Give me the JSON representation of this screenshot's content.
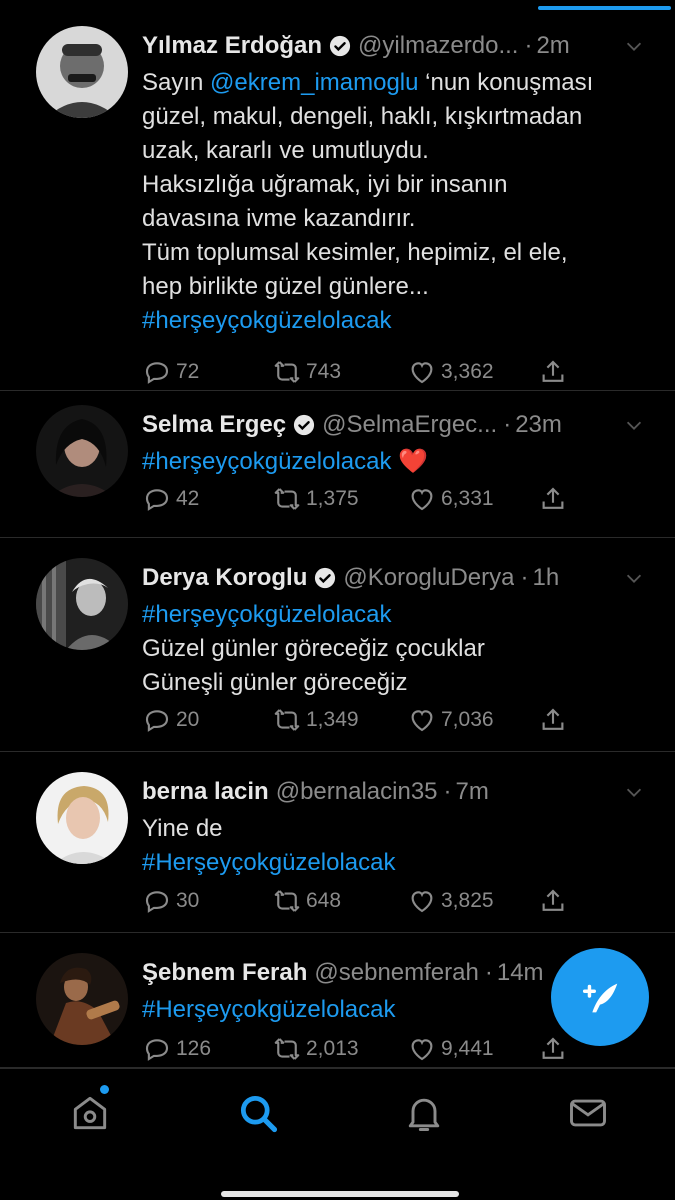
{
  "colors": {
    "accent": "#1d9bf0",
    "background": "#000000",
    "text": "#e0e0e0",
    "muted": "#8b8b8b",
    "heart": "#e0245e"
  },
  "tweets": [
    {
      "name": "Yılmaz Erdoğan",
      "verified": true,
      "handle": "@yilmazerdo...",
      "dot": "·",
      "time": "2m",
      "lines": [
        {
          "parts": [
            {
              "t": "Sayın ",
              "k": "text"
            },
            {
              "t": "@ekrem_imamoglu",
              "k": "mention"
            },
            {
              "t": " ‘nun konuşması",
              "k": "text"
            }
          ]
        },
        {
          "parts": [
            {
              "t": "güzel, makul, dengeli, haklı, kışkırtmadan",
              "k": "text"
            }
          ]
        },
        {
          "parts": [
            {
              "t": "uzak, kararlı ve umutluydu.",
              "k": "text"
            }
          ]
        },
        {
          "parts": [
            {
              "t": "Haksızlığa uğramak, iyi bir insanın",
              "k": "text"
            }
          ]
        },
        {
          "parts": [
            {
              "t": "davasına ivme kazandırır.",
              "k": "text"
            }
          ]
        },
        {
          "parts": [
            {
              "t": "Tüm toplumsal kesimler, hepimiz, el ele,",
              "k": "text"
            }
          ]
        },
        {
          "parts": [
            {
              "t": "hep birlikte güzel günlere...",
              "k": "text"
            }
          ]
        },
        {
          "parts": [
            {
              "t": "#herşeyçokgüzelolacak",
              "k": "hashtag"
            }
          ]
        }
      ],
      "replies": "72",
      "retweets": "743",
      "likes": "3,362"
    },
    {
      "name": "Selma Ergeç",
      "verified": true,
      "handle": "@SelmaErgec...",
      "dot": "·",
      "time": "23m",
      "lines": [
        {
          "parts": [
            {
              "t": "#herşeyçokgüzelolacak",
              "k": "hashtag"
            },
            {
              "t": " ❤️",
              "k": "emoji"
            }
          ]
        }
      ],
      "replies": "42",
      "retweets": "1,375",
      "likes": "6,331"
    },
    {
      "name": "Derya Koroglu",
      "verified": true,
      "handle": "@KorogluDerya",
      "dot": "·",
      "time": "1h",
      "lines": [
        {
          "parts": [
            {
              "t": "#herşeyçokgüzelolacak",
              "k": "hashtag"
            }
          ]
        },
        {
          "parts": [
            {
              "t": "Güzel günler göreceğiz çocuklar",
              "k": "text"
            }
          ]
        },
        {
          "parts": [
            {
              "t": "Güneşli günler göreceğiz",
              "k": "text"
            }
          ]
        }
      ],
      "replies": "20",
      "retweets": "1,349",
      "likes": "7,036"
    },
    {
      "name": "berna lacin",
      "verified": false,
      "handle": "@bernalacin35",
      "dot": "·",
      "time": "7m",
      "lines": [
        {
          "parts": [
            {
              "t": "Yine de",
              "k": "text"
            }
          ]
        },
        {
          "parts": [
            {
              "t": "#Herşeyçokgüzelolacak",
              "k": "hashtag"
            }
          ]
        }
      ],
      "replies": "30",
      "retweets": "648",
      "likes": "3,825"
    },
    {
      "name": "Şebnem Ferah",
      "verified": false,
      "handle": "@sebnemferah",
      "dot": "·",
      "time": "14m",
      "lines": [
        {
          "parts": [
            {
              "t": "#Herşeyçokgüzelolacak",
              "k": "hashtag"
            }
          ]
        }
      ],
      "replies": "126",
      "retweets": "2,013",
      "likes": "9,441"
    }
  ],
  "icons": {
    "reply": "reply-icon",
    "retweet": "retweet-icon",
    "like": "heart-icon",
    "share": "share-icon",
    "compose": "compose-tweet-icon",
    "tabs": [
      "home-icon",
      "search-icon",
      "bell-icon",
      "mail-icon"
    ]
  }
}
